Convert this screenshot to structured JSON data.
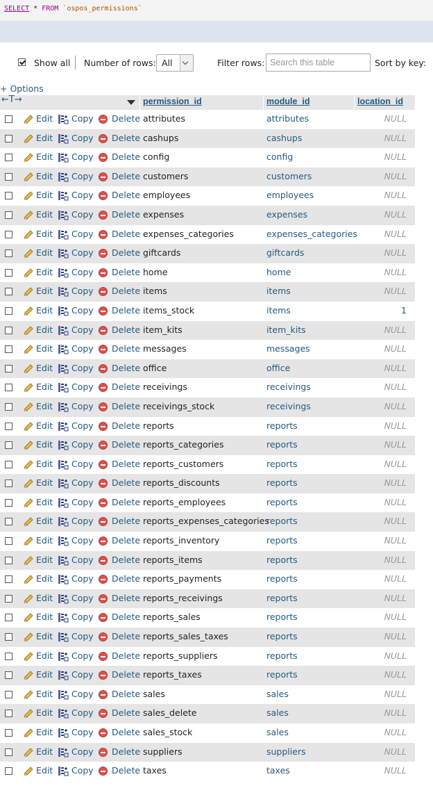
{
  "query": {
    "select_kw": "SELECT",
    "star": "*",
    "from_kw": "FROM",
    "table": "`ospos_permissions`"
  },
  "controls": {
    "show_all_label": "Show all",
    "show_all_checked": true,
    "num_rows_label": "Number of rows:",
    "num_rows_value": "All",
    "filter_label": "Filter rows:",
    "search_placeholder": "Search this table",
    "sort_label": "Sort by key:"
  },
  "options_link": "+ Options",
  "table": {
    "columns": [
      "permission_id",
      "module_id",
      "location_id"
    ],
    "header_arrows": "←T→",
    "action_labels": {
      "edit": "Edit",
      "copy": "Copy",
      "delete": "Delete"
    },
    "rows": [
      {
        "permission_id": "attributes",
        "module_id": "attributes",
        "location_id": "NULL"
      },
      {
        "permission_id": "cashups",
        "module_id": "cashups",
        "location_id": "NULL"
      },
      {
        "permission_id": "config",
        "module_id": "config",
        "location_id": "NULL"
      },
      {
        "permission_id": "customers",
        "module_id": "customers",
        "location_id": "NULL"
      },
      {
        "permission_id": "employees",
        "module_id": "employees",
        "location_id": "NULL"
      },
      {
        "permission_id": "expenses",
        "module_id": "expenses",
        "location_id": "NULL"
      },
      {
        "permission_id": "expenses_categories",
        "module_id": "expenses_categories",
        "location_id": "NULL"
      },
      {
        "permission_id": "giftcards",
        "module_id": "giftcards",
        "location_id": "NULL"
      },
      {
        "permission_id": "home",
        "module_id": "home",
        "location_id": "NULL"
      },
      {
        "permission_id": "items",
        "module_id": "items",
        "location_id": "NULL"
      },
      {
        "permission_id": "items_stock",
        "module_id": "items",
        "location_id": "1"
      },
      {
        "permission_id": "item_kits",
        "module_id": "item_kits",
        "location_id": "NULL"
      },
      {
        "permission_id": "messages",
        "module_id": "messages",
        "location_id": "NULL"
      },
      {
        "permission_id": "office",
        "module_id": "office",
        "location_id": "NULL"
      },
      {
        "permission_id": "receivings",
        "module_id": "receivings",
        "location_id": "NULL"
      },
      {
        "permission_id": "receivings_stock",
        "module_id": "receivings",
        "location_id": "NULL"
      },
      {
        "permission_id": "reports",
        "module_id": "reports",
        "location_id": "NULL"
      },
      {
        "permission_id": "reports_categories",
        "module_id": "reports",
        "location_id": "NULL"
      },
      {
        "permission_id": "reports_customers",
        "module_id": "reports",
        "location_id": "NULL"
      },
      {
        "permission_id": "reports_discounts",
        "module_id": "reports",
        "location_id": "NULL"
      },
      {
        "permission_id": "reports_employees",
        "module_id": "reports",
        "location_id": "NULL"
      },
      {
        "permission_id": "reports_expenses_categories",
        "module_id": "reports",
        "location_id": "NULL"
      },
      {
        "permission_id": "reports_inventory",
        "module_id": "reports",
        "location_id": "NULL"
      },
      {
        "permission_id": "reports_items",
        "module_id": "reports",
        "location_id": "NULL"
      },
      {
        "permission_id": "reports_payments",
        "module_id": "reports",
        "location_id": "NULL"
      },
      {
        "permission_id": "reports_receivings",
        "module_id": "reports",
        "location_id": "NULL"
      },
      {
        "permission_id": "reports_sales",
        "module_id": "reports",
        "location_id": "NULL"
      },
      {
        "permission_id": "reports_sales_taxes",
        "module_id": "reports",
        "location_id": "NULL"
      },
      {
        "permission_id": "reports_suppliers",
        "module_id": "reports",
        "location_id": "NULL"
      },
      {
        "permission_id": "reports_taxes",
        "module_id": "reports",
        "location_id": "NULL"
      },
      {
        "permission_id": "sales",
        "module_id": "sales",
        "location_id": "NULL"
      },
      {
        "permission_id": "sales_delete",
        "module_id": "sales",
        "location_id": "NULL"
      },
      {
        "permission_id": "sales_stock",
        "module_id": "sales",
        "location_id": "NULL"
      },
      {
        "permission_id": "suppliers",
        "module_id": "suppliers",
        "location_id": "NULL"
      },
      {
        "permission_id": "taxes",
        "module_id": "taxes",
        "location_id": "NULL"
      }
    ]
  },
  "colors": {
    "link": "#235a81",
    "row_alt": "#e5e5e5",
    "null_text": "#999999",
    "delete_icon": "#d9534f"
  },
  "icons": {
    "edit": "pencil-icon",
    "copy": "copy-icon",
    "delete": "delete-icon",
    "sort": "sort-desc-icon",
    "dropdown": "chevron-down-icon"
  }
}
